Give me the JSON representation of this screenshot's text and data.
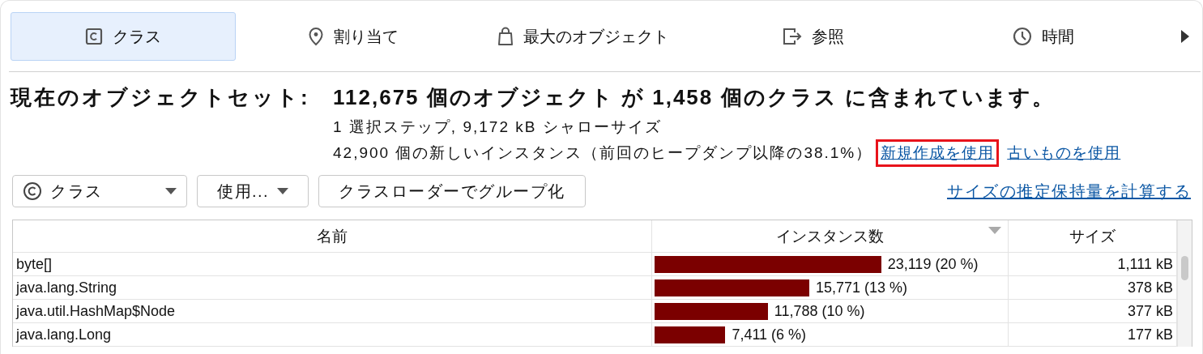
{
  "tabs": [
    {
      "label": "クラス",
      "selected": true
    },
    {
      "label": "割り当て",
      "selected": false
    },
    {
      "label": "最大のオブジェクト",
      "selected": false
    },
    {
      "label": "参照",
      "selected": false
    },
    {
      "label": "時間",
      "selected": false
    }
  ],
  "summary": {
    "label": "現在のオブジェクトセット:",
    "value": "112,675 個のオブジェクト が 1,458 個のクラス に含まれています。",
    "steps": "1 選択ステップ, 9,172 kB シャローサイズ",
    "new_instances": "42,900 個の新しいインスタンス（前回のヒープダンプ以降の38.1%）",
    "links": [
      {
        "label": "新規作成を使用",
        "highlighted": true
      },
      {
        "label": "古いものを使用",
        "highlighted": false
      }
    ]
  },
  "toolbar": {
    "view_select": "クラス",
    "usage_menu": "使用...",
    "group_button": "クラスローダーでグループ化",
    "retained_link": "サイズの推定保持量を計算する"
  },
  "table": {
    "columns": [
      {
        "label": "名前",
        "sorted": false
      },
      {
        "label": "インスタンス数",
        "sorted": true
      },
      {
        "label": "サイズ",
        "sorted": false
      }
    ],
    "rows": [
      {
        "name": "byte[]",
        "count": "23,119 (20 %)",
        "level": 0.64,
        "size": "1,111 kB"
      },
      {
        "name": "java.lang.String",
        "count": "15,771 (13 %)",
        "level": 0.437,
        "size": "378 kB"
      },
      {
        "name": "java.util.HashMap$Node",
        "count": "11,788 (10 %)",
        "level": 0.32,
        "size": "377 kB"
      },
      {
        "name": "java.lang.Long",
        "count": "7,411 (6 %)",
        "level": 0.2,
        "size": "177 kB"
      }
    ]
  }
}
